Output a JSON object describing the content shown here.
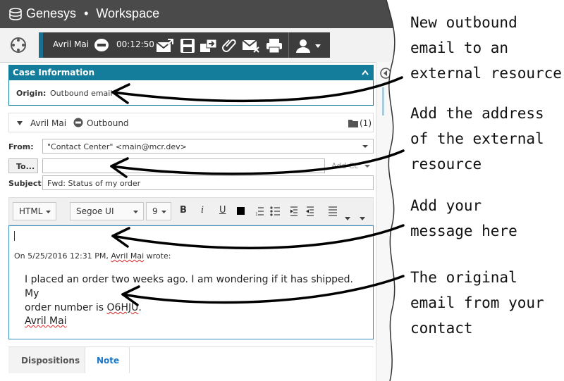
{
  "app": {
    "brand": "Genesys",
    "separator": "•",
    "title": "Workspace"
  },
  "callbar": {
    "contact": "Avril Mai",
    "timer": "00:12:50"
  },
  "case": {
    "header": "Case Information",
    "origin_label": "Origin:",
    "origin_value": "Outbound email"
  },
  "interaction": {
    "contact": "Avril Mai",
    "direction": "Outbound",
    "attachments": "(1)"
  },
  "form": {
    "from_label": "From:",
    "from_value": "\"Contact Center\" <main@mcr.dev>",
    "to_button": "To...",
    "to_value": "",
    "add_cc": "Add Cc",
    "subject_label": "Subject:",
    "subject_value": "Fwd: Status of my order"
  },
  "editor": {
    "format": "HTML",
    "font": "Segoe UI",
    "size": "9",
    "quote_prefix": "On 5/25/2016 12:31 PM, ",
    "quote_name": "Avril Mai",
    "quote_suffix": " wrote:",
    "quote_line1": "I placed an order two weeks ago. I am wondering if it has shipped. My",
    "quote_line2_a": "order number is ",
    "quote_line2_b": "O6HJU",
    "quote_line2_c": ".",
    "signature": "Avril Mai"
  },
  "tabs": {
    "dispositions": "Dispositions",
    "note": "Note"
  },
  "annotations": [
    {
      "lines": [
        "New outbound",
        "email to an",
        "external resource"
      ]
    },
    {
      "lines": [
        "Add the address",
        "of the external",
        "resource"
      ]
    },
    {
      "lines": [
        "Add your",
        "message here"
      ]
    },
    {
      "lines": [
        "The original",
        "email from your",
        "contact"
      ]
    }
  ],
  "colors": {
    "titlebar": "#4a4a4a",
    "accent": "#137d9b",
    "callbar": "#3d3d3d",
    "link": "#1a77c9"
  }
}
